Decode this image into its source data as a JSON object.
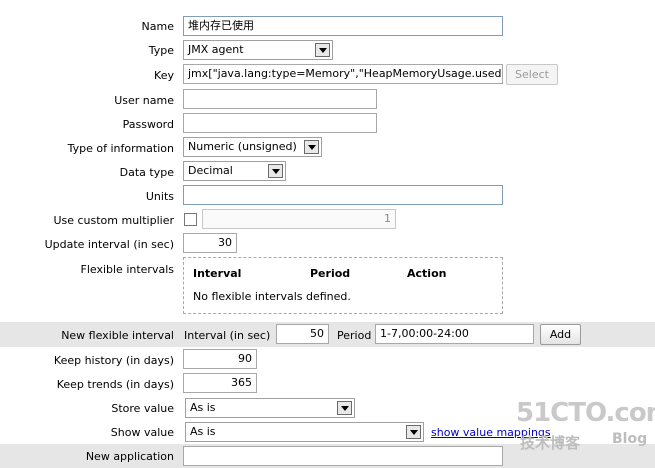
{
  "form": {
    "name": {
      "label": "Name",
      "value": "堆内存已使用"
    },
    "type": {
      "label": "Type",
      "value": "JMX agent"
    },
    "key": {
      "label": "Key",
      "value": "jmx[\"java.lang:type=Memory\",\"HeapMemoryUsage.used",
      "select_label": "Select"
    },
    "username": {
      "label": "User name",
      "value": ""
    },
    "password": {
      "label": "Password",
      "value": ""
    },
    "type_of_information": {
      "label": "Type of information",
      "value": "Numeric (unsigned)"
    },
    "data_type": {
      "label": "Data type",
      "value": "Decimal"
    },
    "units": {
      "label": "Units",
      "value": ""
    },
    "custom_multiplier": {
      "label": "Use custom multiplier",
      "value": "1"
    },
    "update_interval": {
      "label": "Update interval (in sec)",
      "value": "30"
    },
    "flexible_intervals": {
      "label": "Flexible intervals",
      "col_interval": "Interval",
      "col_period": "Period",
      "col_action": "Action",
      "empty": "No flexible intervals defined."
    },
    "new_flexible_interval": {
      "label": "New flexible interval",
      "interval_label": "Interval (in sec)",
      "interval_value": "50",
      "period_label": "Period",
      "period_value": "1-7,00:00-24:00",
      "add_label": "Add"
    },
    "keep_history": {
      "label": "Keep history (in days)",
      "value": "90"
    },
    "keep_trends": {
      "label": "Keep trends (in days)",
      "value": "365"
    },
    "store_value": {
      "label": "Store value",
      "value": "As is"
    },
    "show_value": {
      "label": "Show value",
      "value": "As is",
      "link": "show value mappings"
    },
    "new_application": {
      "label": "New application",
      "value": ""
    }
  },
  "watermark": {
    "site": "51CTO.com",
    "subtitle": "技术博客",
    "blog": "Blog"
  }
}
